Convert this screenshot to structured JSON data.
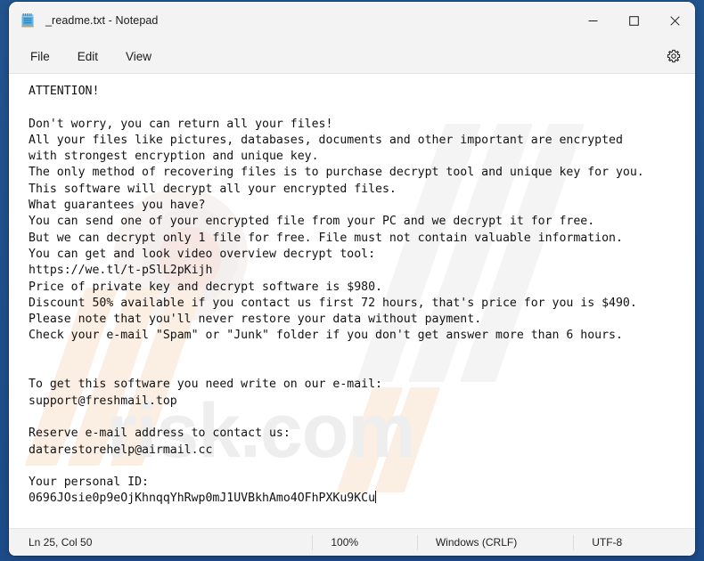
{
  "window": {
    "title": "_readme.txt - Notepad",
    "app_icon": "notepad-icon",
    "controls": {
      "minimize": "─",
      "maximize": "☐",
      "close": "✕"
    }
  },
  "menubar": {
    "items": [
      {
        "label": "File"
      },
      {
        "label": "Edit"
      },
      {
        "label": "View"
      }
    ],
    "settings_icon": "gear-icon"
  },
  "editor": {
    "content": "ATTENTION!\n\nDon't worry, you can return all your files!\nAll your files like pictures, databases, documents and other important are encrypted\nwith strongest encryption and unique key.\nThe only method of recovering files is to purchase decrypt tool and unique key for you.\nThis software will decrypt all your encrypted files.\nWhat guarantees you have?\nYou can send one of your encrypted file from your PC and we decrypt it for free.\nBut we can decrypt only 1 file for free. File must not contain valuable information.\nYou can get and look video overview decrypt tool:\nhttps://we.tl/t-pSlL2pKijh\nPrice of private key and decrypt software is $980.\nDiscount 50% available if you contact us first 72 hours, that's price for you is $490.\nPlease note that you'll never restore your data without payment.\nCheck your e-mail \"Spam\" or \"Junk\" folder if you don't get answer more than 6 hours.\n\n\nTo get this software you need write on our e-mail:\nsupport@freshmail.top\n\nReserve e-mail address to contact us:\ndatarestorehelp@airmail.cc\n\nYour personal ID:\n0696JOsie0p9eOjKhnqqYhRwp0mJ1UVBkhAmo4OFhPXKu9KCu",
    "watermark_text": "risk.com"
  },
  "statusbar": {
    "position": "Ln 25, Col 50",
    "zoom": "100%",
    "line_ending": "Windows (CRLF)",
    "encoding": "UTF-8"
  },
  "colors": {
    "desktop": "#1f5091",
    "chrome": "#f3f3f3",
    "editor_bg": "#ffffff",
    "text": "#121212",
    "watermark_slash": "#fbeee2",
    "watermark_text": "#eeeeee"
  }
}
